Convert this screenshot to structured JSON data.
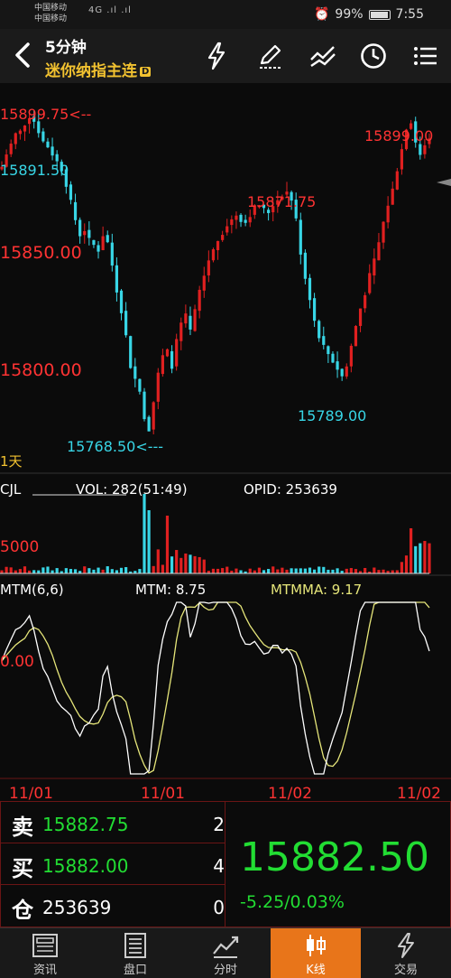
{
  "status_bar": {
    "carrier1": "中国移动",
    "carrier2": "中国移动",
    "signal": "4G .ıl .ıl",
    "battery": "99%",
    "time": "7:55"
  },
  "header": {
    "interval": "5分钟",
    "instrument": "迷你纳指主连",
    "badge": "D"
  },
  "chart": {
    "price_labels": {
      "top_left": "15899.75<--",
      "left_small": "15891.50",
      "peak_right": "15899.00",
      "mid_high": "15871.75",
      "level_15850": "15850.00",
      "level_15800": "15800.00",
      "low_left": "15768.50<---",
      "low_right": "15789.00",
      "period": "1天"
    },
    "volume": {
      "title": "CJL",
      "vol": "VOL: 282(51:49)",
      "opid": "OPID: 253639",
      "axis": "5000"
    },
    "mtm": {
      "title": "MTM(6,6)",
      "mtm_value": "MTM: 8.75",
      "mtmma_value": "MTMMA: 9.17",
      "axis": "0.00"
    },
    "dates": [
      "11/01",
      "11/01",
      "11/02",
      "11/02"
    ],
    "colors": {
      "up": "#e02020",
      "down": "#38d6e6",
      "mtm": "#ffffff",
      "mtmma": "#e6e67a",
      "label_red": "#ff3333",
      "label_cyan": "#38d6e6"
    }
  },
  "chart_data": {
    "type": "candlestick",
    "title": "5分钟",
    "ylim": [
      15762,
      15905
    ],
    "annotations": {
      "high": 15899.75,
      "low": 15768.5,
      "high2": 15899.0,
      "high3": 15871.75,
      "low2": 15789.0
    },
    "price_path": [
      15879,
      15884,
      15888,
      15892,
      15893,
      15896,
      15899,
      15897,
      15893,
      15889,
      15887,
      15884,
      15881,
      15878,
      15872,
      15865,
      15858,
      15852,
      15854,
      15850,
      15848,
      15846,
      15852,
      15849,
      15840,
      15830,
      15822,
      15812,
      15800,
      15795,
      15790,
      15780,
      15775,
      15786,
      15797,
      15804,
      15806,
      15800,
      15810,
      15817,
      15820,
      15814,
      15822,
      15830,
      15836,
      15842,
      15846,
      15850,
      15853,
      15856,
      15858,
      15860,
      15858,
      15857,
      15860,
      15863,
      15864,
      15862,
      15861,
      15864,
      15866,
      15868,
      15869,
      15866,
      15858,
      15845,
      15835,
      15827,
      15818,
      15812,
      15808,
      15805,
      15802,
      15799,
      15796,
      15800,
      15808,
      15816,
      15823,
      15829,
      15836,
      15842,
      15849,
      15857,
      15864,
      15870,
      15878,
      15886,
      15894,
      15897,
      15888,
      15884,
      15888,
      15891
    ],
    "volume": {
      "axis_label": "5000",
      "last": 282,
      "buy_sell": "51:49",
      "opid": 253639
    },
    "mtm": {
      "period": "6,6",
      "mtm_last": 8.75,
      "mtmma_last": 9.17
    },
    "x_labels": [
      "11/01",
      "11/01",
      "11/02",
      "11/02"
    ]
  },
  "quote": {
    "sell_label": "卖",
    "sell_price": "15882.75",
    "sell_qty": "2",
    "buy_label": "买",
    "buy_price": "15882.00",
    "buy_qty": "4",
    "oi_label": "仓",
    "oi_value": "253639",
    "oi_change": "0",
    "last_price": "15882.50",
    "change": "-5.25/0.03%"
  },
  "bottom_nav": [
    {
      "label": "资讯",
      "icon": "news-icon"
    },
    {
      "label": "盘口",
      "icon": "orderbook-icon"
    },
    {
      "label": "分时",
      "icon": "timeshare-icon"
    },
    {
      "label": "K线",
      "icon": "candlestick-icon",
      "active": true
    },
    {
      "label": "交易",
      "icon": "trade-icon"
    }
  ]
}
